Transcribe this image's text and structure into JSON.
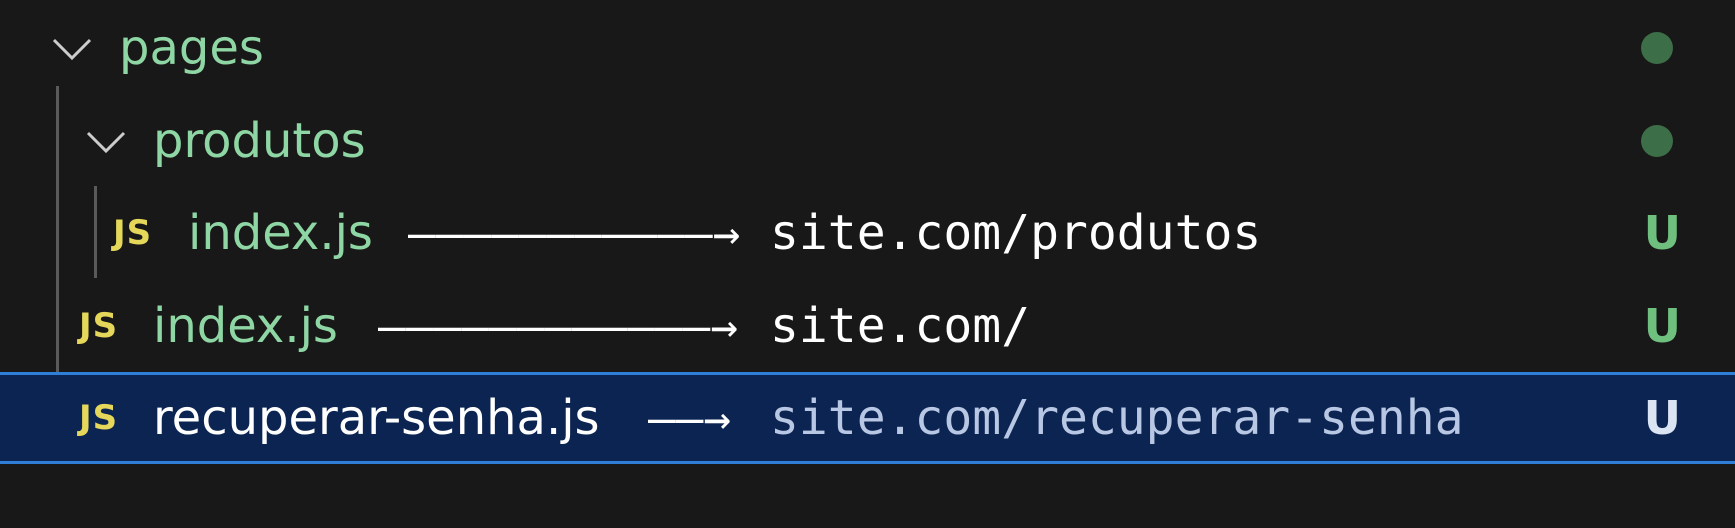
{
  "explorer": {
    "folders": [
      {
        "label": "pages",
        "status": "modified-dot"
      },
      {
        "label": "produtos",
        "status": "modified-dot"
      }
    ],
    "files": [
      {
        "label": "index.js",
        "icon": "JS",
        "arrow": "———————————→",
        "route": "site.com/produtos",
        "status": "U"
      },
      {
        "label": "index.js",
        "icon": "JS",
        "arrow": "————————————→",
        "route": "site.com/",
        "status": "U"
      },
      {
        "label": "recuperar-senha.js",
        "icon": "JS",
        "arrow": "——→",
        "route": "site.com/recuperar-senha",
        "status": "U"
      }
    ]
  },
  "colors": {
    "background": "#181818",
    "folder_text": "#8fd6a5",
    "js_icon": "#e5d75a",
    "untracked_badge": "#6fbf7f",
    "selection_bg": "#0c2452",
    "selection_border": "#2f7ed8"
  }
}
